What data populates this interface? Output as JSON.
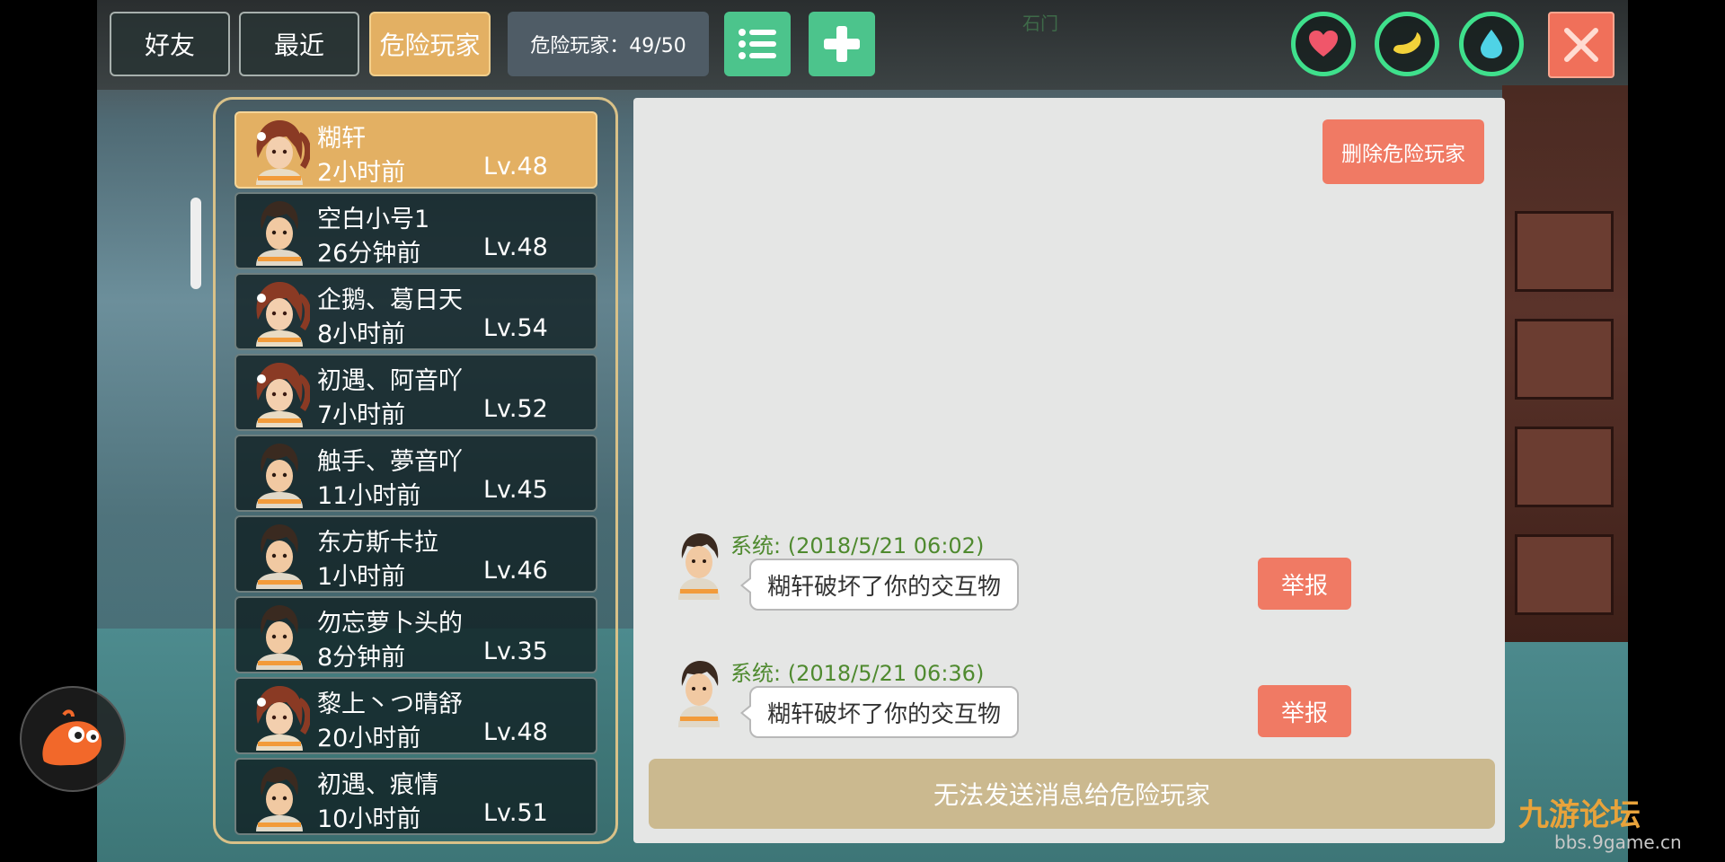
{
  "tabs": {
    "friends": "好友",
    "recent": "最近",
    "danger": "危险玩家"
  },
  "danger_count": "危险玩家：49/50",
  "toolbar": {
    "list_icon": "list-icon",
    "add_icon": "plus-icon",
    "close_icon": "close-icon"
  },
  "status_rings": [
    {
      "icon": "heart-icon",
      "color": "#f0566a"
    },
    {
      "icon": "food-icon",
      "color": "#f2d23a"
    },
    {
      "icon": "water-drop-icon",
      "color": "#4fd3e6"
    }
  ],
  "scene": {
    "door_label": "石门"
  },
  "players": [
    {
      "name": "糊轩",
      "time": "2小时前",
      "level": "Lv.48",
      "avatar": "female",
      "selected": true
    },
    {
      "name": "空白小号1",
      "time": "26分钟前",
      "level": "Lv.48",
      "avatar": "male",
      "selected": false
    },
    {
      "name": "企鹅、葛日天",
      "time": "8小时前",
      "level": "Lv.54",
      "avatar": "female",
      "selected": false
    },
    {
      "name": "初遇、阿音吖",
      "time": "7小时前",
      "level": "Lv.52",
      "avatar": "female",
      "selected": false
    },
    {
      "name": "触手、夢音吖",
      "time": "11小时前",
      "level": "Lv.45",
      "avatar": "male",
      "selected": false
    },
    {
      "name": "东方斯卡拉",
      "time": "1小时前",
      "level": "Lv.46",
      "avatar": "male",
      "selected": false
    },
    {
      "name": "勿忘萝卜头的",
      "time": "8分钟前",
      "level": "Lv.35",
      "avatar": "male",
      "selected": false
    },
    {
      "name": "黎上丶つ晴舒",
      "time": "20小时前",
      "level": "Lv.48",
      "avatar": "female",
      "selected": false
    },
    {
      "name": "初遇、痕情",
      "time": "10小时前",
      "level": "Lv.51",
      "avatar": "male",
      "selected": false
    }
  ],
  "chat": {
    "delete_button": "删除危险玩家",
    "messages": [
      {
        "sender": "系统:",
        "timestamp": "(2018/5/21 06:02)",
        "text": "糊轩破坏了你的交互物",
        "report": "举报"
      },
      {
        "sender": "系统:",
        "timestamp": "(2018/5/21 06:36)",
        "text": "糊轩破坏了你的交互物",
        "report": "举报"
      }
    ],
    "notice": "无法发送消息给危险玩家"
  },
  "watermark": {
    "title": "九游论坛",
    "url": "bbs.9game.cn"
  },
  "colors": {
    "accent_gold": "#e3b063",
    "accent_green": "#4cc48c",
    "danger_red": "#f07a64",
    "ring_green": "#3fe08c"
  }
}
